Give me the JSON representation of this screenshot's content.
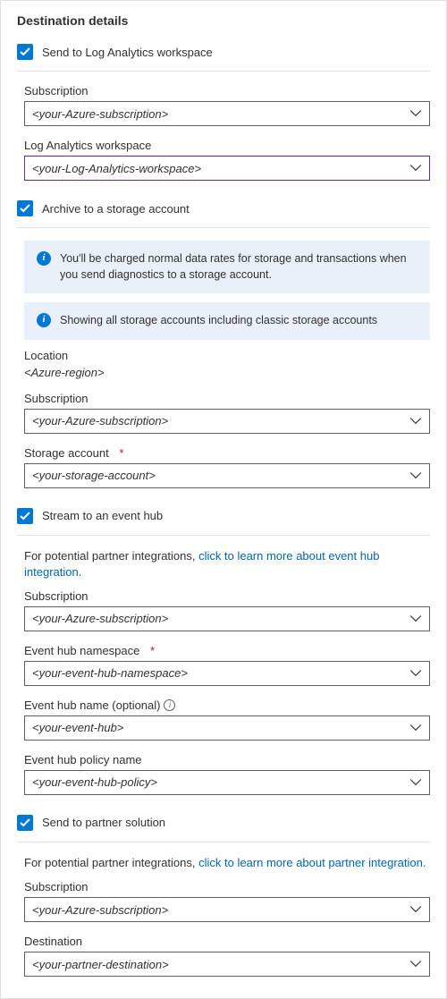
{
  "title": "Destination details",
  "logAnalytics": {
    "checkboxLabel": "Send to Log Analytics workspace",
    "subscriptionLabel": "Subscription",
    "subscriptionValue": "<your-Azure-subscription>",
    "workspaceLabel": "Log Analytics workspace",
    "workspaceValue": "<your-Log-Analytics-workspace>"
  },
  "storage": {
    "checkboxLabel": "Archive to a storage account",
    "info1": "You'll be charged normal data rates for storage and transactions when you send diagnostics to a storage account.",
    "info2": "Showing all storage accounts including classic storage accounts",
    "locationLabel": "Location",
    "locationValue": "<Azure-region>",
    "subscriptionLabel": "Subscription",
    "subscriptionValue": "<your-Azure-subscription>",
    "storageLabel": "Storage account",
    "storageValue": "<your-storage-account>"
  },
  "eventHub": {
    "checkboxLabel": "Stream to an event hub",
    "helperPrefix": "For potential partner integrations, ",
    "helperLink": "click to learn more about event hub integration.",
    "subscriptionLabel": "Subscription",
    "subscriptionValue": "<your-Azure-subscription>",
    "namespaceLabel": "Event hub namespace",
    "namespaceValue": "<your-event-hub-namespace>",
    "nameLabel": "Event hub name (optional)",
    "nameValue": "<your-event-hub>",
    "policyLabel": "Event hub policy name",
    "policyValue": "<your-event-hub-policy>"
  },
  "partner": {
    "checkboxLabel": "Send to partner solution",
    "helperPrefix": "For potential partner integrations, ",
    "helperLink": "click to learn more about partner integration.",
    "subscriptionLabel": "Subscription",
    "subscriptionValue": "<your-Azure-subscription>",
    "destinationLabel": "Destination",
    "destinationValue": "<your-partner-destination>"
  },
  "requiredMark": "*"
}
